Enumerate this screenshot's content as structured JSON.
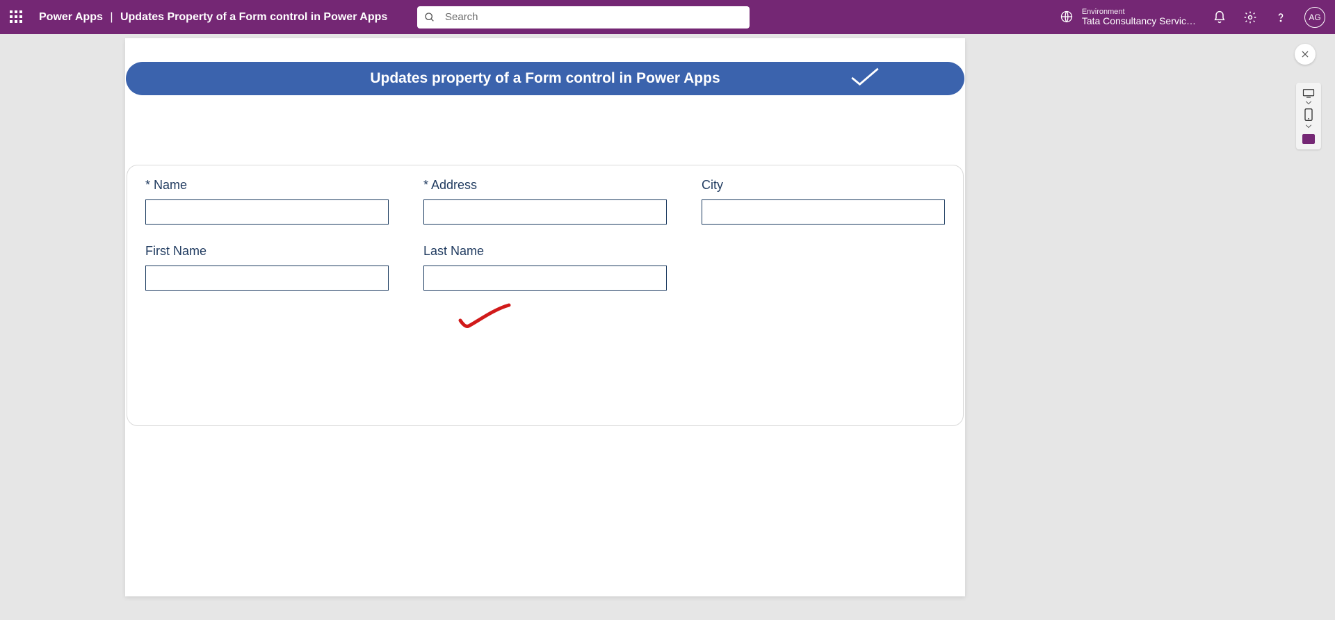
{
  "topbar": {
    "app_name": "Power Apps",
    "page_title": "Updates Property of a Form control in Power Apps",
    "search_placeholder": "Search"
  },
  "environment": {
    "label": "Environment",
    "name": "Tata Consultancy Servic…"
  },
  "user": {
    "initials": "AG"
  },
  "canvas": {
    "banner_title": "Updates property of a Form control in Power Apps"
  },
  "form": {
    "fields": [
      {
        "label": "* Name",
        "value": ""
      },
      {
        "label": "* Address",
        "value": ""
      },
      {
        "label": "City",
        "value": ""
      },
      {
        "label": "First Name",
        "value": ""
      },
      {
        "label": "Last Name",
        "value": ""
      }
    ]
  }
}
